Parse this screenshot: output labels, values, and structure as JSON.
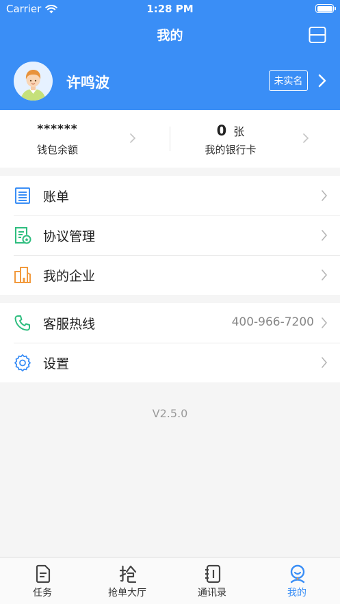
{
  "status_bar": {
    "carrier": "Carrier",
    "time": "1:28 PM"
  },
  "nav": {
    "title": "我的"
  },
  "profile": {
    "name": "许鸣波",
    "verify_badge": "未实名"
  },
  "wallet": {
    "balance_value": "******",
    "balance_label": "钱包余额",
    "card_count": "0",
    "card_unit": "张",
    "card_label": "我的银行卡"
  },
  "menu_group1": [
    {
      "label": "账单",
      "icon": "bill-icon"
    },
    {
      "label": "协议管理",
      "icon": "agreement-icon"
    },
    {
      "label": "我的企业",
      "icon": "enterprise-icon"
    }
  ],
  "menu_group2": [
    {
      "label": "客服热线",
      "value": "400-966-7200",
      "icon": "phone-icon"
    },
    {
      "label": "设置",
      "icon": "settings-icon"
    }
  ],
  "version": "V2.5.0",
  "tabbar": [
    {
      "label": "任务",
      "icon": "task-icon",
      "active": false
    },
    {
      "label": "抢单大厅",
      "icon": "grab-order-icon",
      "active": false
    },
    {
      "label": "通讯录",
      "icon": "contacts-icon",
      "active": false
    },
    {
      "label": "我的",
      "icon": "profile-icon",
      "active": true
    }
  ],
  "colors": {
    "primary": "#3a8ef6",
    "green": "#2dbd7e",
    "orange": "#f29a3d",
    "text": "#222222",
    "muted": "#888888"
  }
}
